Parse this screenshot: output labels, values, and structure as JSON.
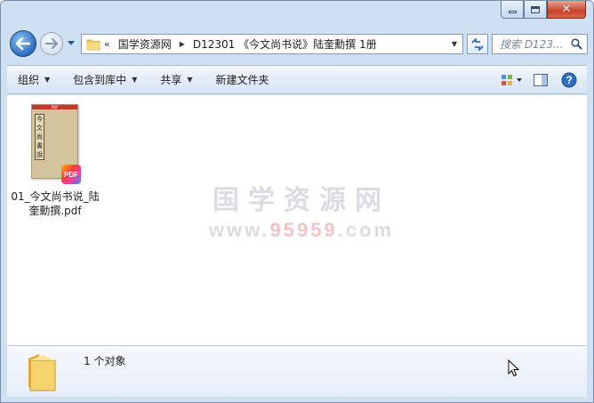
{
  "window": {
    "caption_buttons": {
      "minimize": "minimize",
      "maximize": "maximize",
      "close": "close"
    }
  },
  "nav": {
    "back_icon": "back-arrow-icon",
    "forward_icon": "forward-arrow-icon"
  },
  "address": {
    "overflow": "«",
    "segments": [
      "国学资源网",
      "D12301 《今文尚书说》陆奎勳撰 1册"
    ]
  },
  "search": {
    "placeholder": "搜索 D123..."
  },
  "toolbar": {
    "organize": "组织",
    "include_library": "包含到库中",
    "share": "共享",
    "new_folder": "新建文件夹"
  },
  "files": [
    {
      "name": "01_今文尚书说_陆奎勳撰.pdf",
      "thumb_title_chars": [
        "今",
        "文",
        "尚",
        "書",
        "說"
      ],
      "thumb_header": "PDF",
      "badge": "PDF"
    }
  ],
  "watermark": {
    "line1": "国学资源网",
    "line2_prefix": "www.",
    "line2_domain": "95959",
    "line2_suffix": ".com"
  },
  "details": {
    "count_text": "1 个对象"
  },
  "colors": {
    "accent": "#2c6fbf",
    "frame": "#cfe0f3",
    "close": "#c7422a"
  }
}
